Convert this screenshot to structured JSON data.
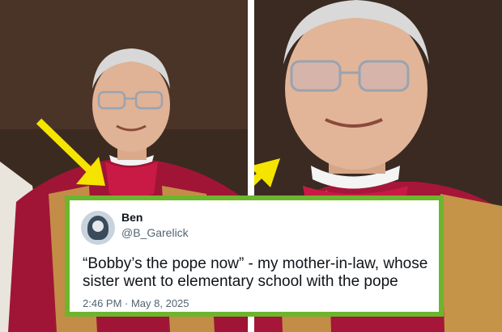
{
  "tweet": {
    "author_name": "Ben",
    "author_handle": "@B_Garelick",
    "text": "“Bobby’s the pope now” - my mother-in-law, whose sister went to elementary school with the pope",
    "timestamp": "2:46 PM · May 8, 2025"
  },
  "colors": {
    "tweet_border": "#6cb52d",
    "arrow": "#f5e400",
    "vestment_red": "#b3163b",
    "gold": "#c9a24a"
  },
  "icons": [
    "avatar-image",
    "arrow-icon"
  ]
}
